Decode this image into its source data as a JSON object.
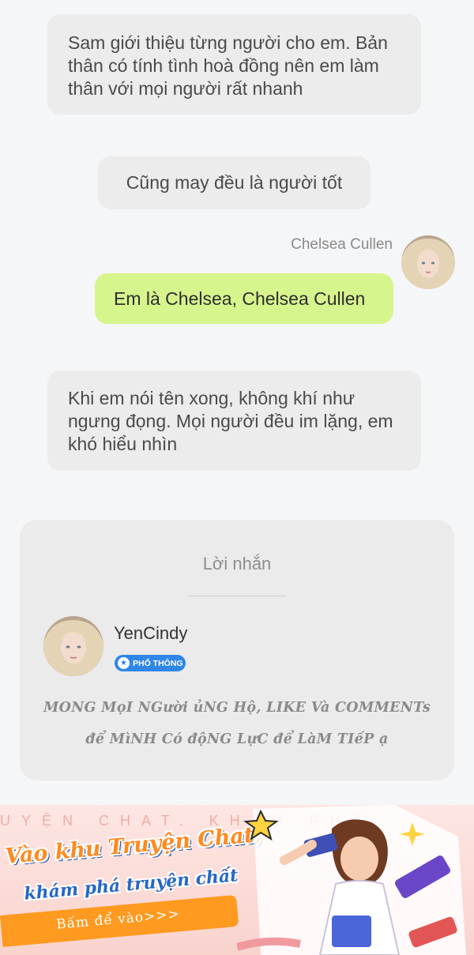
{
  "messages": [
    {
      "text": "Sam giới thiệu từng người cho em. Bản thân có tính tình hoà đồng nên em làm thân với mọi người rất nhanh"
    },
    {
      "text": "Cũng may đều là người tốt"
    },
    {
      "speaker": "Chelsea Cullen",
      "text": "Em là Chelsea, Chelsea Cullen"
    },
    {
      "text": "Khi em nói tên xong, không khí như ngưng đọng. Mọi người đều im lặng, em khó hiểu nhìn"
    }
  ],
  "author_card": {
    "title": "Lời nhắn",
    "author_name": "YenCindy",
    "badge": "PHỔ THÔNG",
    "note_line1": "MONG MọI NGười ủNG Hộ, LIKE Và COMMENTs",
    "note_line2": "để MìNH Có độNG LựC để LàM TIếP ạ"
  },
  "banner": {
    "deco_text": "UYỆN CHAT. KHÁM PHÁ",
    "line1": "Vào khu Truyện Chat,",
    "line2": "khám phá truyện chất",
    "button": "Bấm để vào>>>"
  },
  "colors": {
    "background": "#f5f6f8",
    "narration_bubble": "#ececec",
    "speech_bubble": "#d7f58d",
    "badge": "#2f86e6",
    "banner_orange": "#ff8a1f"
  }
}
